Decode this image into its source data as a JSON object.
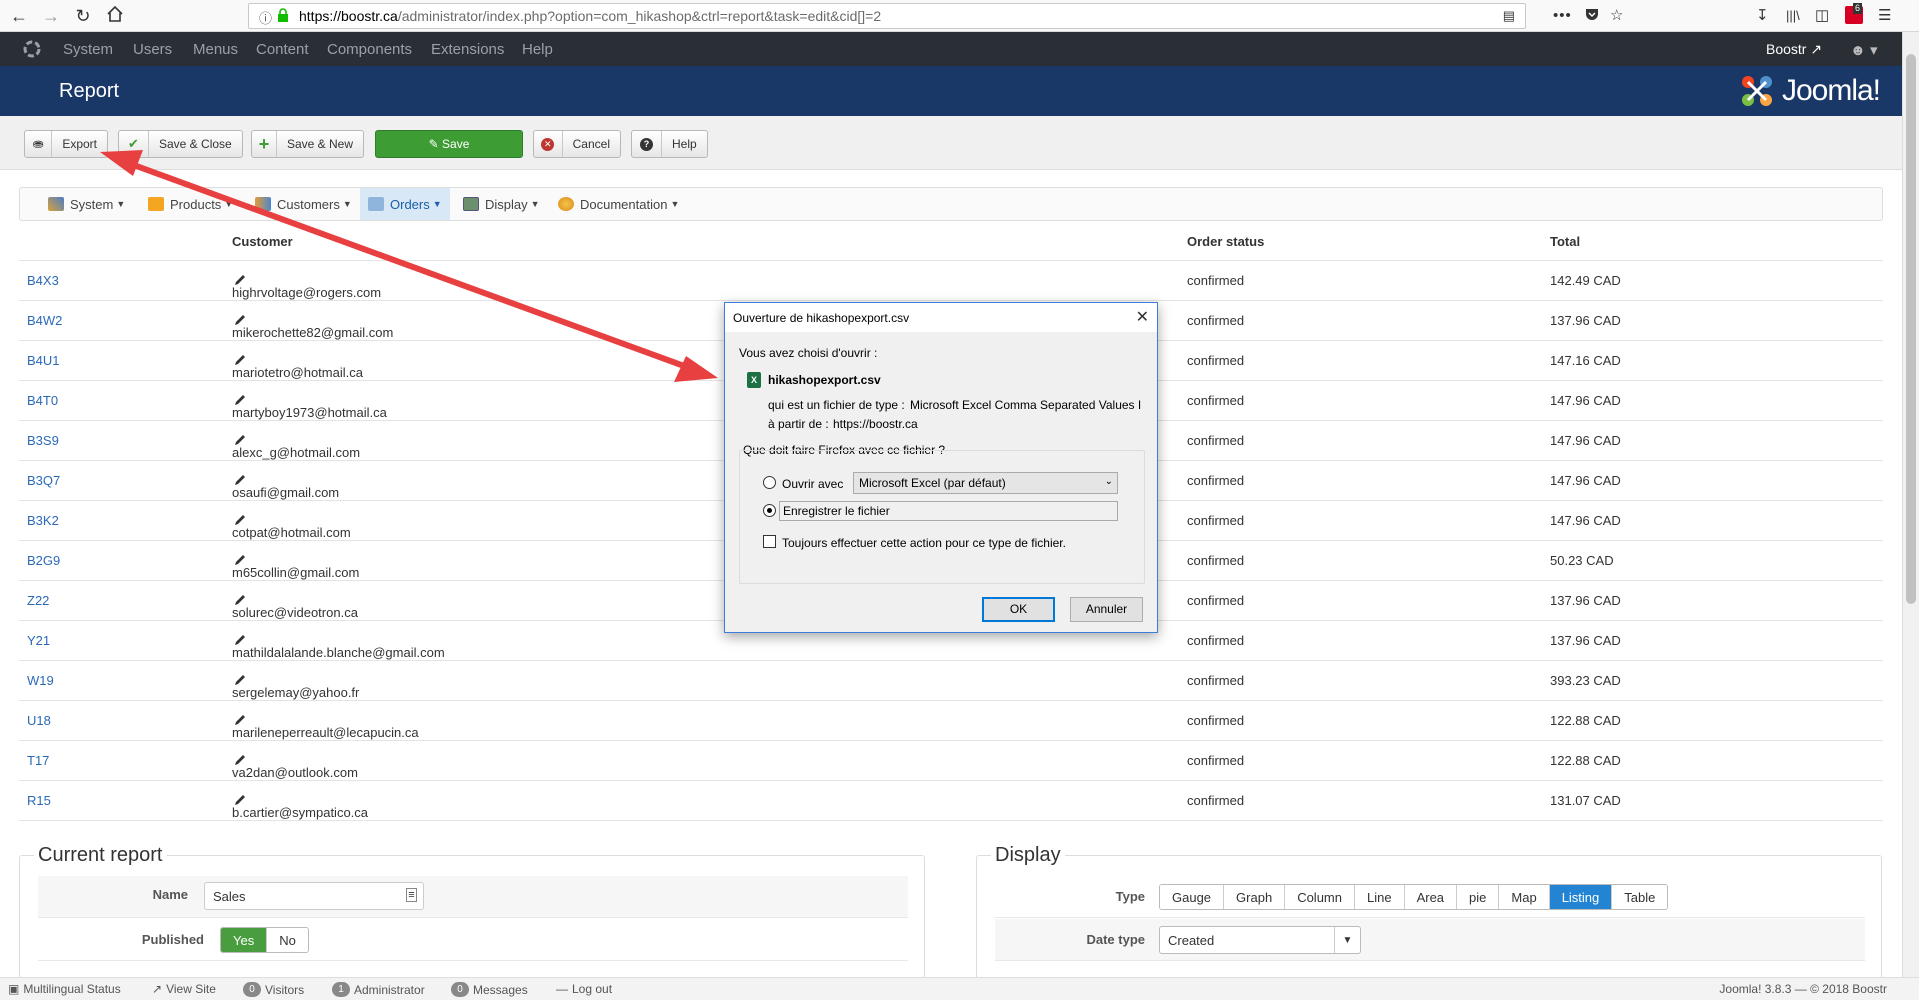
{
  "browser": {
    "url_host": "https://boostr.ca",
    "url_path": "/administrator/index.php?option=com_hikashop&ctrl=report&task=edit&cid[]=2",
    "menu_dots": "•••",
    "notification_count": "6"
  },
  "joomla_nav": {
    "items": [
      "System",
      "Users",
      "Menus",
      "Content",
      "Components",
      "Extensions",
      "Help"
    ],
    "site_name": "Boostr",
    "logo_text": "Joomla!"
  },
  "header": {
    "title": "Report"
  },
  "toolbar": {
    "export": "Export",
    "save_close": "Save & Close",
    "save_new": "Save & New",
    "save": "Save",
    "cancel": "Cancel",
    "help": "Help"
  },
  "submenu": {
    "items": [
      "System",
      "Products",
      "Customers",
      "Orders",
      "Display",
      "Documentation"
    ],
    "active": "Orders"
  },
  "table": {
    "headers": {
      "customer": "Customer",
      "status": "Order status",
      "total": "Total"
    },
    "rows": [
      {
        "id": "B4X3",
        "customer": "highrvoltage@rogers.com",
        "status": "confirmed",
        "total": "142.49 CAD"
      },
      {
        "id": "B4W2",
        "customer": "mikerochette82@gmail.com",
        "status": "confirmed",
        "total": "137.96 CAD"
      },
      {
        "id": "B4U1",
        "customer": "mariotetro@hotmail.ca",
        "status": "confirmed",
        "total": "147.16 CAD"
      },
      {
        "id": "B4T0",
        "customer": "martyboy1973@hotmail.ca",
        "status": "confirmed",
        "total": "147.96 CAD"
      },
      {
        "id": "B3S9",
        "customer": "alexc_g@hotmail.com",
        "status": "confirmed",
        "total": "147.96 CAD"
      },
      {
        "id": "B3Q7",
        "customer": "osaufi@gmail.com",
        "status": "confirmed",
        "total": "147.96 CAD"
      },
      {
        "id": "B3K2",
        "customer": "cotpat@hotmail.com",
        "status": "confirmed",
        "total": "147.96 CAD"
      },
      {
        "id": "B2G9",
        "customer": "m65collin@gmail.com",
        "status": "confirmed",
        "total": "50.23 CAD"
      },
      {
        "id": "Z22",
        "customer": "solurec@videotron.ca",
        "status": "confirmed",
        "total": "137.96 CAD"
      },
      {
        "id": "Y21",
        "customer": "mathildalalande.blanche@gmail.com",
        "status": "confirmed",
        "total": "137.96 CAD"
      },
      {
        "id": "W19",
        "customer": "sergelemay@yahoo.fr",
        "status": "confirmed",
        "total": "393.23 CAD"
      },
      {
        "id": "U18",
        "customer": "marileneperreault@lecapucin.ca",
        "status": "confirmed",
        "total": "122.88 CAD"
      },
      {
        "id": "T17",
        "customer": "va2dan@outlook.com",
        "status": "confirmed",
        "total": "122.88 CAD"
      },
      {
        "id": "R15",
        "customer": "b.cartier@sympatico.ca",
        "status": "confirmed",
        "total": "131.07 CAD"
      }
    ]
  },
  "current_report": {
    "legend": "Current report",
    "name_label": "Name",
    "name_value": "Sales",
    "published_label": "Published",
    "yes": "Yes",
    "no": "No"
  },
  "display": {
    "legend": "Display",
    "type_label": "Type",
    "types": [
      "Gauge",
      "Graph",
      "Column",
      "Line",
      "Area",
      "pie",
      "Map",
      "Listing",
      "Table"
    ],
    "active_type": "Listing",
    "date_type_label": "Date type",
    "date_type_value": "Created"
  },
  "statusbar": {
    "multilingual": "Multilingual Status",
    "view_site": "View Site",
    "visitors_count": "0",
    "visitors": "Visitors",
    "admin_count": "1",
    "administrator": "Administrator",
    "messages_count": "0",
    "messages": "Messages",
    "logout": "Log out",
    "version": "Joomla! 3.8.3 — © 2018 Boostr"
  },
  "dialog": {
    "title": "Ouverture de hikashopexport.csv",
    "chosen": "Vous avez choisi d'ouvrir :",
    "filename": "hikashopexport.csv",
    "type_prefix": "qui est un fichier de type :",
    "type_value": "Microsoft Excel Comma Separated Values I",
    "from_prefix": "à partir de :",
    "from_value": "https://boostr.ca",
    "question": "Que doit faire Firefox avec ce fichier ?",
    "open_with": "Ouvrir avec",
    "open_app": "Microsoft Excel (par défaut)",
    "save_file": "Enregistrer le fichier",
    "always": "Toujours effectuer cette action pour ce type de fichier.",
    "ok": "OK",
    "cancel": "Annuler"
  },
  "colors": {
    "accent_blue": "#1a3867",
    "nav_dark": "#2a2f36",
    "save_green": "#3e9c35",
    "arrow_red": "#e84040",
    "link_blue": "#2a69b8"
  }
}
